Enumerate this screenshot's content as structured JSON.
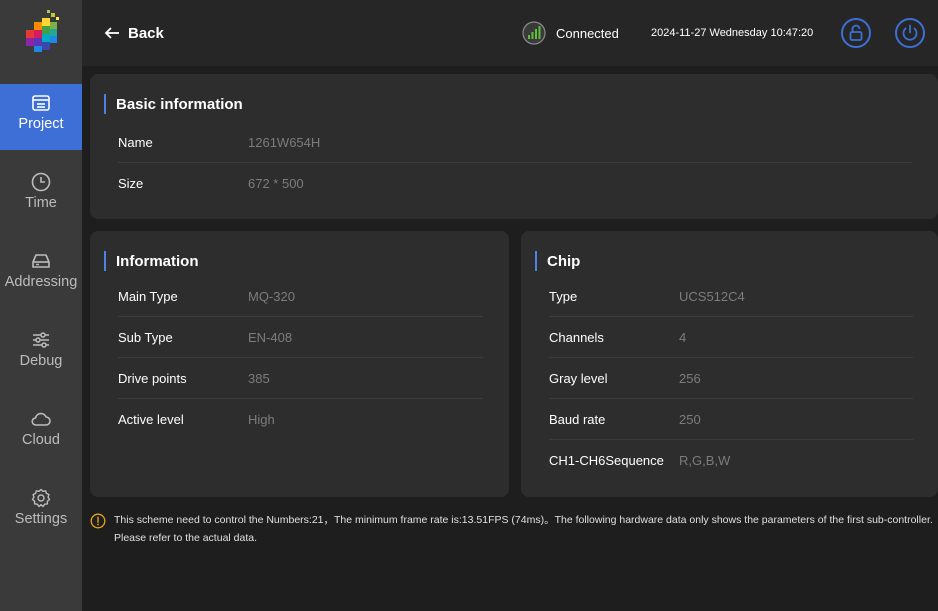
{
  "sidebar": {
    "items": [
      {
        "label": "Project",
        "icon": "project-icon",
        "active": true
      },
      {
        "label": "Time",
        "icon": "clock-icon"
      },
      {
        "label": "Addressing",
        "icon": "hard-drive-icon"
      },
      {
        "label": "Debug",
        "icon": "sliders-icon"
      },
      {
        "label": "Cloud",
        "icon": "cloud-icon"
      },
      {
        "label": "Settings",
        "icon": "gear-icon"
      }
    ]
  },
  "topbar": {
    "back_label": "Back",
    "connection_status": "Connected",
    "datetime": "2024-11-27 Wednesday 10:47:20"
  },
  "basic_info": {
    "title": "Basic information",
    "rows": [
      {
        "key": "Name",
        "value": "1261W654H"
      },
      {
        "key": "Size",
        "value": "672 * 500"
      }
    ]
  },
  "information": {
    "title": "Information",
    "rows": [
      {
        "key": "Main Type",
        "value": "MQ-320"
      },
      {
        "key": "Sub Type",
        "value": "EN-408"
      },
      {
        "key": "Drive points",
        "value": "385"
      },
      {
        "key": "Active level",
        "value": "High"
      }
    ]
  },
  "chip": {
    "title": "Chip",
    "rows": [
      {
        "key": "Type",
        "value": "UCS512C4"
      },
      {
        "key": "Channels",
        "value": "4"
      },
      {
        "key": "Gray level",
        "value": "256"
      },
      {
        "key": "Baud rate",
        "value": "250"
      },
      {
        "key": "CH1-CH6Sequence",
        "value": "R,G,B,W"
      }
    ]
  },
  "notice": {
    "text": "This scheme need to control the Numbers:21，The minimum frame rate is:13.51FPS (74ms)。The following hardware data only shows the parameters of the first sub-controller. Please refer to the actual data."
  },
  "colors": {
    "accent": "#3d6fd6",
    "title_bar": "#4a82e8",
    "warning": "#e8a317",
    "connected": "#5fbf3a"
  }
}
